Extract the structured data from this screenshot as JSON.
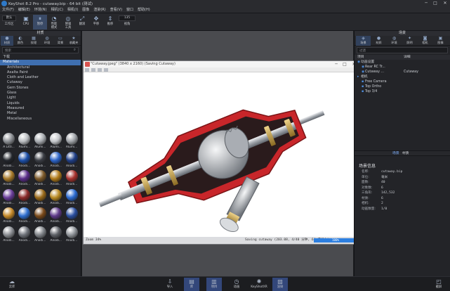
{
  "window": {
    "title": "KeyShot 8.2 Pro - cutaway.bip - 64 bit (测试)",
    "minimize": "─",
    "maximize": "□",
    "close": "✕"
  },
  "menu": [
    "文件(F)",
    "编辑(E)",
    "环境(N)",
    "相机(C)",
    "相机(I)",
    "图像",
    "渲染(R)",
    "查看(V)",
    "窗口",
    "帮助(H)"
  ],
  "toolbar": {
    "workspace_select": "默认",
    "workspace_label": "工作区",
    "buttons": [
      {
        "icon": "cpu-icon",
        "glyph": "▣",
        "label": "CPU"
      },
      {
        "icon": "pause-icon",
        "glyph": "⏸",
        "label": "暂停"
      },
      {
        "icon": "performance-icon",
        "glyph": "◔",
        "label": "性能",
        "label2": "模式"
      },
      {
        "icon": "denoise-icon",
        "glyph": "◎",
        "label": "降噪",
        "label2": "工具"
      },
      {
        "icon": "translate-icon",
        "glyph": "⤢",
        "label": "翻滚"
      },
      {
        "icon": "pan-icon",
        "glyph": "✥",
        "label": "平移"
      },
      {
        "icon": "dolly-icon",
        "glyph": "⇕",
        "label": "推移"
      }
    ],
    "fov_value": "135",
    "fov_label": "视角"
  },
  "library": {
    "title": "材质",
    "tabs": [
      "材质",
      "颜色",
      "纹理",
      "环境",
      "背景",
      "收藏夹"
    ],
    "search_placeholder": "搜索",
    "tree": [
      "下载",
      "Materials",
      "Architectural",
      "Axalta Paint",
      "Cloth and Leather",
      "Cutaway",
      "Gem Stones",
      "Glass",
      "Light",
      "Liquids",
      "Measured",
      "Metal",
      "Miscellaneous"
    ],
    "thumbnails": [
      {
        "label": "A Littl...",
        "color": "#8a8d92"
      },
      {
        "label": "Alumi...",
        "color": "#b9bcc0"
      },
      {
        "label": "Alumi...",
        "color": "#a7abb0"
      },
      {
        "label": "Alumi...",
        "color": "#c3c6ca"
      },
      {
        "label": "Alumi...",
        "color": "#9ea2a7"
      },
      {
        "label": "Anodi...",
        "color": "#23262c"
      },
      {
        "label": "Anodi...",
        "color": "#1c4fa8"
      },
      {
        "label": "Anodi...",
        "color": "#3a3d44"
      },
      {
        "label": "Anodi...",
        "color": "#2b63c8"
      },
      {
        "label": "Anodi...",
        "color": "#1f3e86"
      },
      {
        "label": "Anodi...",
        "color": "#a77a2a"
      },
      {
        "label": "Anodi...",
        "color": "#5a2d8a"
      },
      {
        "label": "Anodi...",
        "color": "#7d5a2a"
      },
      {
        "label": "Anodi...",
        "color": "#b07a18"
      },
      {
        "label": "Anodi...",
        "color": "#a8332e"
      },
      {
        "label": "Anodi...",
        "color": "#6a3d9a"
      },
      {
        "label": "Anodi...",
        "color": "#8a2a2a"
      },
      {
        "label": "Anodi...",
        "color": "#9a6a1a"
      },
      {
        "label": "Anodi...",
        "color": "#b88a22"
      },
      {
        "label": "Anodi...",
        "color": "#2a6ad0"
      },
      {
        "label": "Anodi...",
        "color": "#c58a2a"
      },
      {
        "label": "Anodi...",
        "color": "#2f6fd0"
      },
      {
        "label": "Anodi...",
        "color": "#7a4a1a"
      },
      {
        "label": "Anodi...",
        "color": "#5e3a8a"
      },
      {
        "label": "Anodi...",
        "color": "#2a4fa0"
      },
      {
        "label": "Anodi...",
        "color": "#8a8d92"
      },
      {
        "label": "Anodi...",
        "color": "#6f737a"
      },
      {
        "label": "Anodi...",
        "color": "#7f8388"
      },
      {
        "label": "Anodi...",
        "color": "#5d6066"
      },
      {
        "label": "Anodi...",
        "color": "#8f9398"
      }
    ]
  },
  "image_window": {
    "title": "\"Cutaway.jpeg\" (3840 x 2160) (Saving Cutaway)",
    "zoom": "Zoom 34%",
    "saving_text": "Saving cutaway (203.08, 4/40 分钟, 64 子样本)",
    "progress_label": "100%",
    "progress": 1.0
  },
  "scene": {
    "title": "场景",
    "tabs": [
      "场景",
      "材质",
      "环境",
      "照明",
      "相机",
      "图像"
    ],
    "filter_label": "过滤",
    "col_item": "项目",
    "col_detail": "详细",
    "tree": [
      {
        "label": "动画设置",
        "detail": "",
        "indent": 0
      },
      {
        "label": "Rear RC Tr...",
        "detail": "",
        "indent": 1
      },
      {
        "label": "Cutaway ...",
        "detail": "Cutaway",
        "indent": 1
      },
      {
        "label": "相机",
        "detail": "",
        "indent": 0
      },
      {
        "label": "Free Camera",
        "detail": "",
        "indent": 1
      },
      {
        "label": "Top Ortho",
        "detail": "",
        "indent": 1
      },
      {
        "label": "Top 3/4",
        "detail": "",
        "indent": 1
      }
    ],
    "subtabs": [
      "场景",
      "材质"
    ],
    "info_title": "场景信息",
    "info": [
      {
        "k": "名称:",
        "v": "cutaway.bip"
      },
      {
        "k": "单位:",
        "v": "毫米"
      },
      {
        "k": "面数:",
        "v": "40"
      },
      {
        "k": "对象数:",
        "v": "6"
      },
      {
        "k": "三角形:",
        "v": "142,532"
      },
      {
        "k": "材质:",
        "v": "6"
      },
      {
        "k": "相机:",
        "v": "2"
      },
      {
        "k": "动画数量:",
        "v": "1/0"
      }
    ]
  },
  "bottom": {
    "left": {
      "label": "云库",
      "icon": "cloud-icon"
    },
    "center": [
      {
        "label": "导入",
        "icon": "import-icon",
        "glyph": "⇩"
      },
      {
        "label": "库",
        "icon": "library-icon",
        "glyph": "▤"
      },
      {
        "label": "项目",
        "icon": "project-icon",
        "glyph": "▥"
      },
      {
        "label": "动画",
        "icon": "animation-icon",
        "glyph": "◷"
      },
      {
        "label": "KeyShotXR",
        "icon": "xr-icon",
        "glyph": "✺"
      },
      {
        "label": "渲染",
        "icon": "render-icon",
        "glyph": "▨"
      }
    ],
    "right": {
      "label": "截屏",
      "icon": "screenshot-icon"
    }
  },
  "colors": {
    "accent": "#3f6fb0",
    "housing_red": "#c8262a",
    "brass": "#c9a24a"
  }
}
